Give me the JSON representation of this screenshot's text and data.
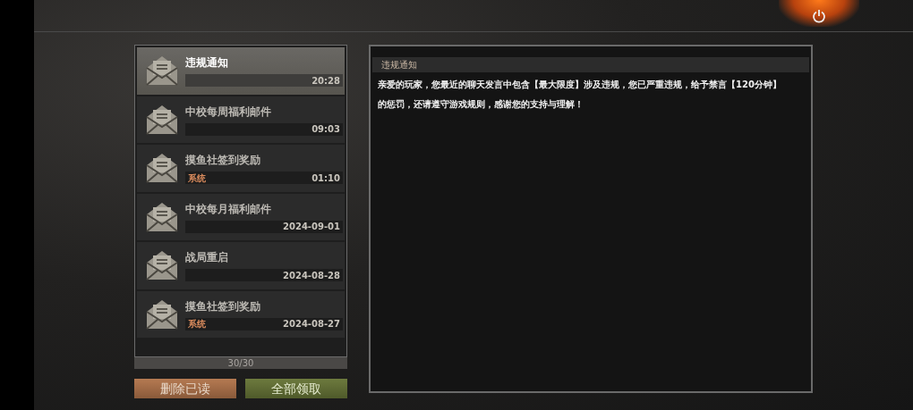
{
  "mails": [
    {
      "title": "违规通知",
      "time": "20:28",
      "selected": true
    },
    {
      "title": "中校每周福利邮件",
      "time": "09:03",
      "selected": false
    },
    {
      "title": "摸鱼社签到奖励",
      "sender": "系统",
      "time": "01:10",
      "selected": false
    },
    {
      "title": "中校每月福利邮件",
      "time": "2024-09-01",
      "selected": false
    },
    {
      "title": "战局重启",
      "time": "2024-08-28",
      "selected": false
    },
    {
      "title": "摸鱼社签到奖励",
      "sender": "系统",
      "time": "2024-08-27",
      "selected": false
    }
  ],
  "count": "30/30",
  "buttons": [
    {
      "label": "删除已读",
      "kind": "delete"
    },
    {
      "label": "全部领取",
      "kind": "claim"
    }
  ],
  "detail": {
    "title": "违规通知",
    "body": "亲爱的玩家，您最近的聊天发言中包含【最大限度】涉及违规，您已严重违规，给予禁言【120分钟】的惩罚，还请遵守游戏规则，感谢您的支持与理解！"
  }
}
